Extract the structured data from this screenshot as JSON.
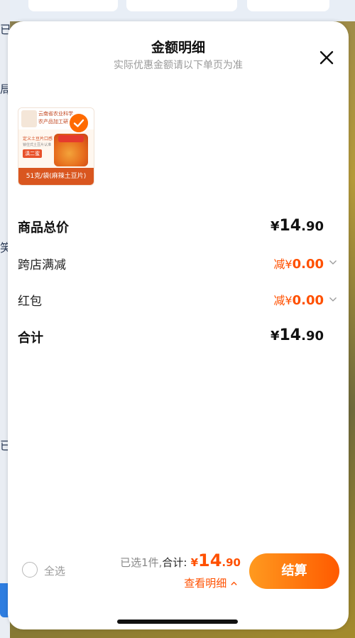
{
  "background": {
    "left_chars": [
      "已",
      "局",
      "笑",
      "已"
    ]
  },
  "sheet": {
    "title": "金额明细",
    "subtitle": "实际优惠金额请以下单页为准"
  },
  "product": {
    "info_line1": "云南省农业科学",
    "info_line2": "农产品加工研究",
    "promo_text": "定义土豆片口感",
    "promo_sub": "锁住式土豆片认准",
    "brand": "滇二蜜",
    "badge": "51克/袋(麻辣土豆片)",
    "selected": true
  },
  "rows": {
    "goods_total": {
      "label": "商品总价",
      "currency": "¥",
      "int": "14",
      "dec": ".90"
    },
    "cross_store": {
      "label": "跨店满减",
      "prefix": "减",
      "currency": "¥",
      "amount": "0.00"
    },
    "red_packet": {
      "label": "红包",
      "prefix": "减",
      "currency": "¥",
      "amount": "0.00"
    },
    "total": {
      "label": "合计",
      "currency": "¥",
      "int": "14",
      "dec": ".90"
    }
  },
  "footer": {
    "select_all": "全选",
    "selected_count": "已选1件,",
    "total_label": "合计:",
    "currency": "¥",
    "total_int": "14",
    "total_dec": ".90",
    "detail_link": "查看明细",
    "checkout": "结算"
  },
  "colors": {
    "accent": "#ff5000",
    "checkout_gradient_start": "#ff9a1f",
    "checkout_gradient_end": "#ff5a00"
  },
  "icons": {
    "close": "close-icon",
    "chevron": "chevron-down-icon",
    "check": "check-icon",
    "chevron_up": "chevron-up-icon"
  }
}
